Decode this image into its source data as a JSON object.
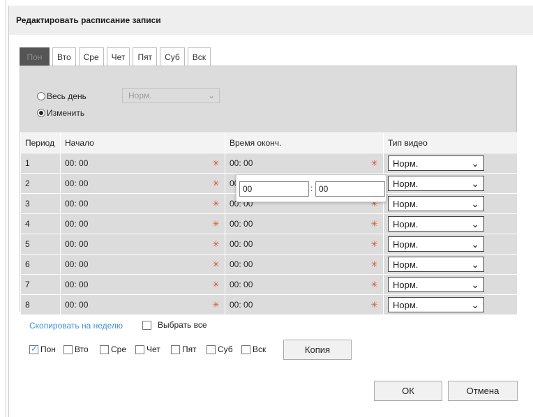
{
  "dialog": {
    "title": "Редактировать расписание записи"
  },
  "tabs": [
    "Пон",
    "Вто",
    "Сре",
    "Чет",
    "Пят",
    "Суб",
    "Вск"
  ],
  "mode": {
    "all_day_label": "Весь день",
    "all_day_select": "Норм.",
    "edit_label": "Изменить",
    "selected": "edit"
  },
  "table": {
    "headers": [
      "Период",
      "Начало",
      "Время оконч.",
      "Тип видео"
    ],
    "rows": [
      {
        "period": "1",
        "start": "00: 00",
        "end": "00: 00",
        "type": "Норм."
      },
      {
        "period": "2",
        "start": "00: 00",
        "end": "00: 00",
        "type": "Норм."
      },
      {
        "period": "3",
        "start": "00: 00",
        "end": "00: 00",
        "type": "Норм."
      },
      {
        "period": "4",
        "start": "00: 00",
        "end": "00: 00",
        "type": "Норм."
      },
      {
        "period": "5",
        "start": "00: 00",
        "end": "00: 00",
        "type": "Норм."
      },
      {
        "period": "6",
        "start": "00: 00",
        "end": "00: 00",
        "type": "Норм."
      },
      {
        "period": "7",
        "start": "00: 00",
        "end": "00: 00",
        "type": "Норм."
      },
      {
        "period": "8",
        "start": "00: 00",
        "end": "00: 00",
        "type": "Норм."
      }
    ]
  },
  "time_popup": {
    "hours": "00",
    "colon": ":",
    "minutes": "00"
  },
  "copy": {
    "link": "Скопировать на неделю",
    "select_all": "Выбрать все",
    "days": [
      {
        "label": "Пон",
        "checked": true
      },
      {
        "label": "Вто",
        "checked": false
      },
      {
        "label": "Сре",
        "checked": false
      },
      {
        "label": "Чет",
        "checked": false
      },
      {
        "label": "Пят",
        "checked": false
      },
      {
        "label": "Суб",
        "checked": false
      },
      {
        "label": "Вск",
        "checked": false
      }
    ],
    "copy_button": "Копия"
  },
  "buttons": {
    "ok": "ОК",
    "cancel": "Отмена"
  },
  "icons": {
    "calendar": "calendar-icon",
    "chevron": "chevron-down-icon"
  },
  "colors": {
    "link": "#3a8fd6",
    "active_tab": "#555555",
    "panel": "#dcdcdc",
    "calendar_icon": "#d9502a"
  }
}
